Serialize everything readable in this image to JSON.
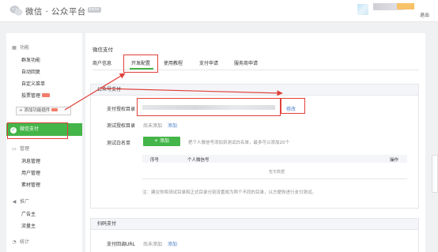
{
  "header": {
    "brand": "微信 · 公众平台",
    "badge": "beta",
    "logout": "退出"
  },
  "sidebar": {
    "sections": [
      {
        "title": "功能",
        "icon": "grid-icon",
        "items": [
          "群发功能",
          "自动回复",
          "自定义菜单",
          "投票管理"
        ]
      },
      {
        "title": "管理",
        "icon": "monitor-icon",
        "items": [
          "消息管理",
          "用户管理",
          "素材管理"
        ]
      },
      {
        "title": "推广",
        "icon": "megaphone-icon",
        "items": [
          "广告主",
          "流量主"
        ]
      },
      {
        "title": "统计",
        "icon": "chart-icon",
        "items": []
      }
    ],
    "add_plugin": "+ 添加功能插件",
    "active_item": "微信支付"
  },
  "main": {
    "title": "微信支付",
    "tabs": [
      "商户信息",
      "开发配置",
      "使用教程",
      "支付申请",
      "服务商申请"
    ],
    "active_tab": "开发配置",
    "card1": {
      "title": "公众号支付",
      "rows": {
        "pay_dir_label": "支付授权目录",
        "pay_dir_action": "修改",
        "test_dir_label": "测试授权目录",
        "test_dir_value": "尚未添加",
        "test_dir_action": "添加",
        "whitelist_label": "测试白名单",
        "whitelist_button": "+ 添加",
        "whitelist_hint": "把个人微信号添加到测试白名单，最多可以添加20个"
      },
      "table": {
        "columns": [
          "序号",
          "个人微信号",
          "操作"
        ],
        "empty_text": "暂无数据"
      },
      "note": "注：建议你将测试目录和正式目录分别设置成为两个不同的目录，以方便你进行支付测试。"
    },
    "card2": {
      "title": "扫码支付",
      "rows": {
        "callback_label": "支付回调URL",
        "callback_value": "尚未添加",
        "callback_action": "添加"
      }
    }
  },
  "colors": {
    "accent": "#44b549",
    "link": "#4b7ec9",
    "annotation": "#e0403a"
  }
}
